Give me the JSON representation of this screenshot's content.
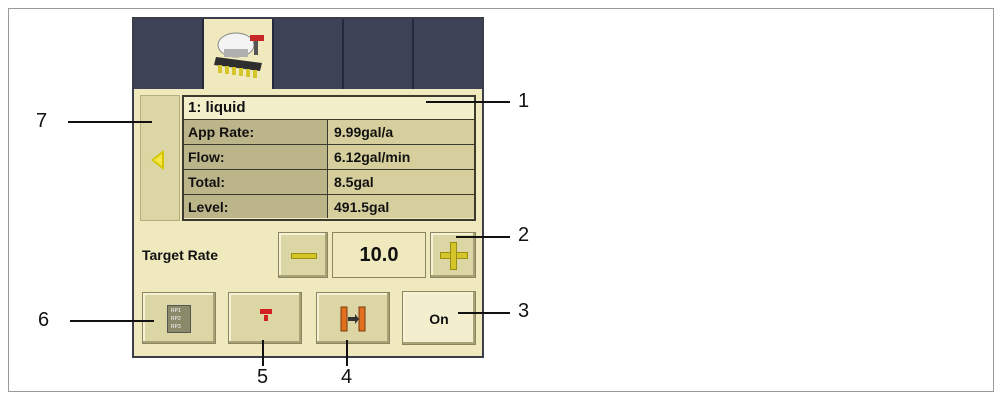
{
  "product": {
    "title": "1: liquid",
    "rows": [
      {
        "label": "App Rate:",
        "value": "9.99gal/a"
      },
      {
        "label": "Flow:",
        "value": "6.12gal/min"
      },
      {
        "label": "Total:",
        "value": "8.5gal"
      },
      {
        "label": "Level:",
        "value": "491.5gal"
      }
    ]
  },
  "target_rate": {
    "label": "Target Rate",
    "value": "10.0"
  },
  "buttons": {
    "on_label": "On",
    "product_icon_lines": [
      "RP1",
      "RP2",
      "RP3"
    ]
  },
  "callouts": [
    "1",
    "2",
    "3",
    "4",
    "5",
    "6",
    "7"
  ],
  "colors": {
    "panel_bg": "#efe9bd",
    "tab_bg": "#3d4256",
    "accent_yellow": "#d4c62a",
    "label_cell": "#bcb58a",
    "value_cell": "#d6cf9d"
  }
}
